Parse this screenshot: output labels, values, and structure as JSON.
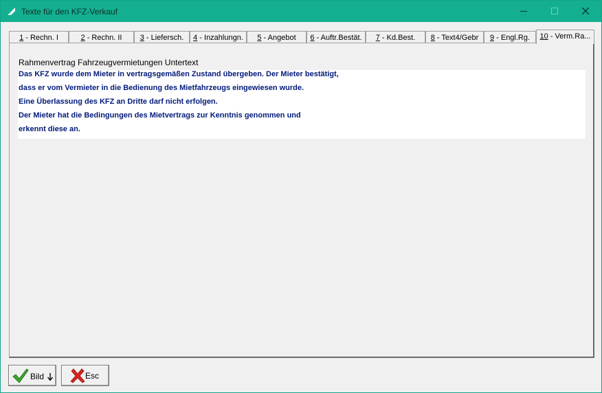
{
  "window": {
    "title": "Texte für den KFZ-Verkauf"
  },
  "tabs": [
    {
      "key": "1",
      "rest": " - Rechn. I"
    },
    {
      "key": "2",
      "rest": " - Rechn. II"
    },
    {
      "key": "3",
      "rest": " - Liefersch."
    },
    {
      "key": "4",
      "rest": " - Inzahlungn."
    },
    {
      "key": "5",
      "rest": " - Angebot"
    },
    {
      "key": "6",
      "rest": " - Auftr.Bestät."
    },
    {
      "key": "7",
      "rest": " - Kd.Best."
    },
    {
      "key": "8",
      "rest": " - Text4/Gebr"
    },
    {
      "key": "9",
      "rest": " - Engl.Rg."
    },
    {
      "key": "10",
      "rest": " - Verm.Ra..."
    }
  ],
  "active_tab_index": 9,
  "panel": {
    "subtitle": "Rahmenvertrag Fahrzeugvermietungen Untertext",
    "lines": [
      "Das KFZ wurde dem Mieter in vertragsgemäßen Zustand übergeben.  Der Mieter bestätigt,",
      "dass er vom Vermieter in die Bedienung des Mietfahrzeugs eingewiesen wurde.",
      "Eine Überlassung des KFZ an Dritte darf nicht erfolgen.",
      "Der Mieter hat die Bedingungen des Mietvertrags zur Kenntnis genommen und",
      "erkennt diese an."
    ]
  },
  "buttons": {
    "bild_label": "Bild",
    "esc_label": "Esc"
  },
  "colors": {
    "titlebar": "#13af90",
    "body_text": "#001a7a"
  },
  "icons": [
    "app-icon",
    "minimize-icon",
    "maximize-icon",
    "close-icon",
    "checkmark-icon",
    "arrow-down-icon",
    "red-x-icon"
  ]
}
